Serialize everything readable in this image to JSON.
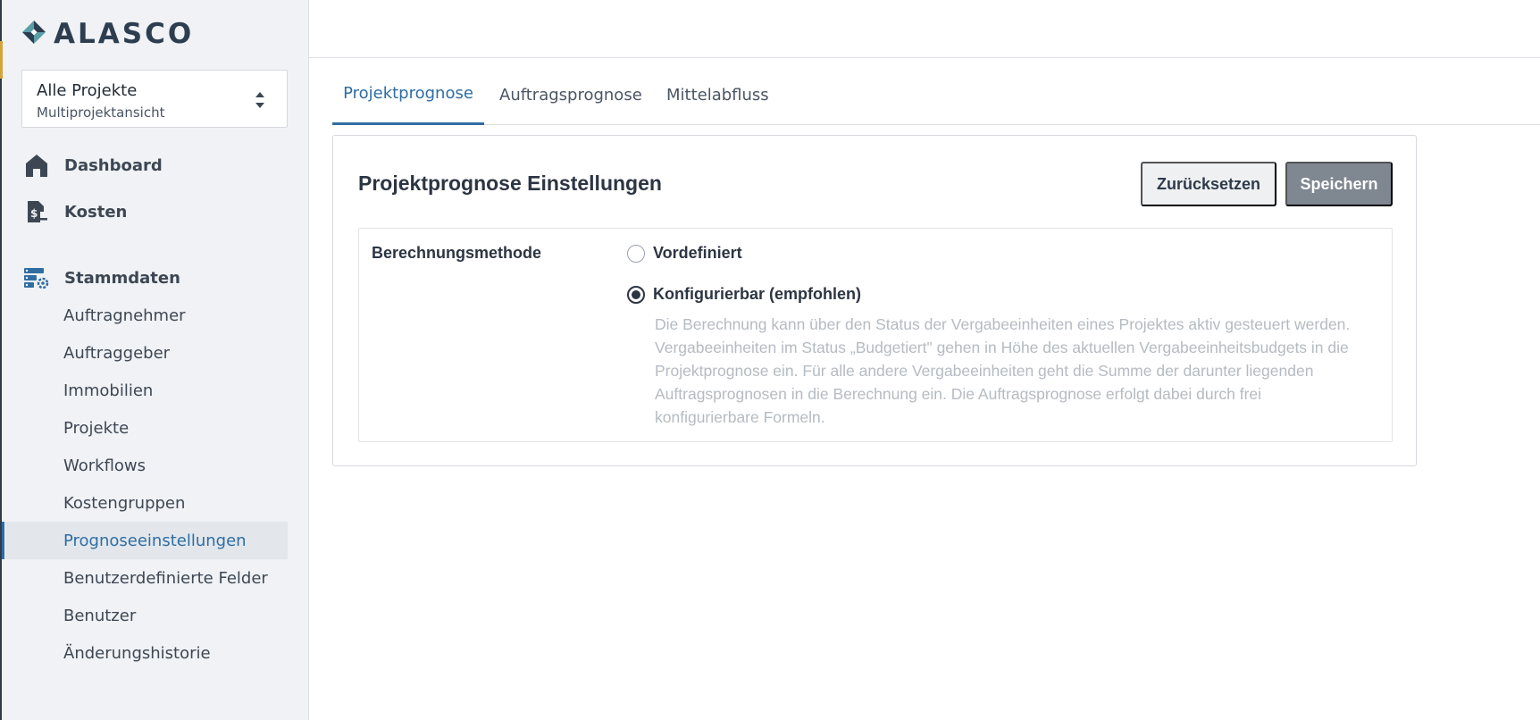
{
  "app": {
    "logo_text": "ALASCO"
  },
  "project_selector": {
    "title": "Alle Projekte",
    "subtitle": "Multiprojektansicht"
  },
  "sidebar": {
    "nav": [
      {
        "label": "Dashboard",
        "icon": "home-icon"
      },
      {
        "label": "Kosten",
        "icon": "cost-document-icon"
      },
      {
        "label": "Stammdaten",
        "icon": "master-data-settings-icon"
      }
    ],
    "sub_items": [
      {
        "label": "Auftragnehmer"
      },
      {
        "label": "Auftraggeber"
      },
      {
        "label": "Immobilien"
      },
      {
        "label": "Projekte"
      },
      {
        "label": "Workflows"
      },
      {
        "label": "Kostengruppen"
      },
      {
        "label": "Prognoseeinstellungen",
        "active": true
      },
      {
        "label": "Benutzerdefinierte Felder"
      },
      {
        "label": "Benutzer"
      },
      {
        "label": "Änderungshistorie"
      }
    ]
  },
  "tabs": [
    {
      "label": "Projektprognose",
      "active": true
    },
    {
      "label": "Auftragsprognose"
    },
    {
      "label": "Mittelabfluss"
    }
  ],
  "settings_card": {
    "title": "Projektprognose Einstellungen",
    "reset_label": "Zurücksetzen",
    "save_label": "Speichern",
    "field_label": "Berechnungsmethode",
    "options": [
      {
        "label": "Vordefiniert",
        "checked": false
      },
      {
        "label": "Konfigurierbar (empfohlen)",
        "checked": true
      }
    ],
    "description": "Die Berechnung kann über den Status der Vergabeeinheiten eines Projektes aktiv gesteuert werden. Vergabeeinheiten im Status „Budgetiert\" gehen in Höhe des aktuellen Vergabeeinheitsbudgets in die Projektprognose ein. Für alle andere Vergabeeinheiten geht die Summe der darunter liegenden Auftragsprognosen in die Berechnung ein. Die Auftragsprognose erfolgt dabei durch frei konfigurierbare Formeln."
  },
  "colors": {
    "accent": "#2f6da3",
    "sidebar_bg": "#f0f2f5",
    "save_button": "#7f8791"
  }
}
